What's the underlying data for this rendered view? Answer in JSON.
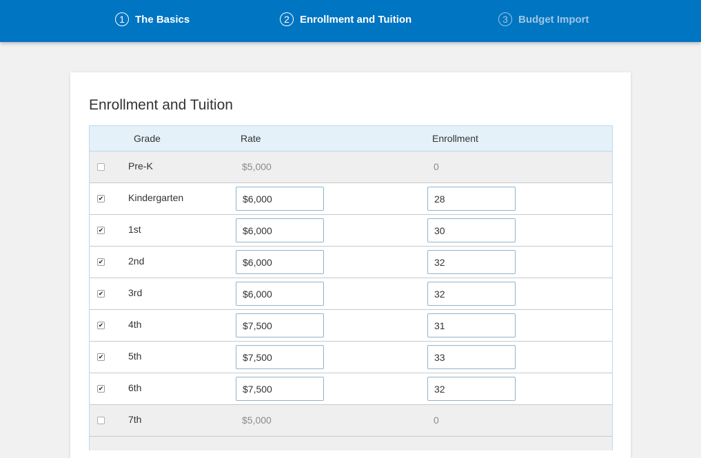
{
  "steps": [
    {
      "num": "1",
      "label": "The Basics",
      "state": "complete"
    },
    {
      "num": "2",
      "label": "Enrollment and Tuition",
      "state": "active"
    },
    {
      "num": "3",
      "label": "Budget Import",
      "state": "inactive"
    }
  ],
  "card": {
    "title": "Enrollment and Tuition"
  },
  "table": {
    "headers": {
      "grade": "Grade",
      "rate": "Rate",
      "enrollment": "Enrollment"
    },
    "rows": [
      {
        "checked": false,
        "grade": "Pre-K",
        "rate": "$5,000",
        "enrollment": "0"
      },
      {
        "checked": true,
        "grade": "Kindergarten",
        "rate": "$6,000",
        "enrollment": "28"
      },
      {
        "checked": true,
        "grade": "1st",
        "rate": "$6,000",
        "enrollment": "30"
      },
      {
        "checked": true,
        "grade": "2nd",
        "rate": "$6,000",
        "enrollment": "32"
      },
      {
        "checked": true,
        "grade": "3rd",
        "rate": "$6,000",
        "enrollment": "32"
      },
      {
        "checked": true,
        "grade": "4th",
        "rate": "$7,500",
        "enrollment": "31"
      },
      {
        "checked": true,
        "grade": "5th",
        "rate": "$7,500",
        "enrollment": "33"
      },
      {
        "checked": true,
        "grade": "6th",
        "rate": "$7,500",
        "enrollment": "32"
      },
      {
        "checked": false,
        "grade": "7th",
        "rate": "$5,000",
        "enrollment": "0"
      }
    ]
  },
  "colors": {
    "topbar": "#0075c2",
    "inactive_step": "#9fc7e6",
    "header_bg": "#e5f1f9"
  }
}
